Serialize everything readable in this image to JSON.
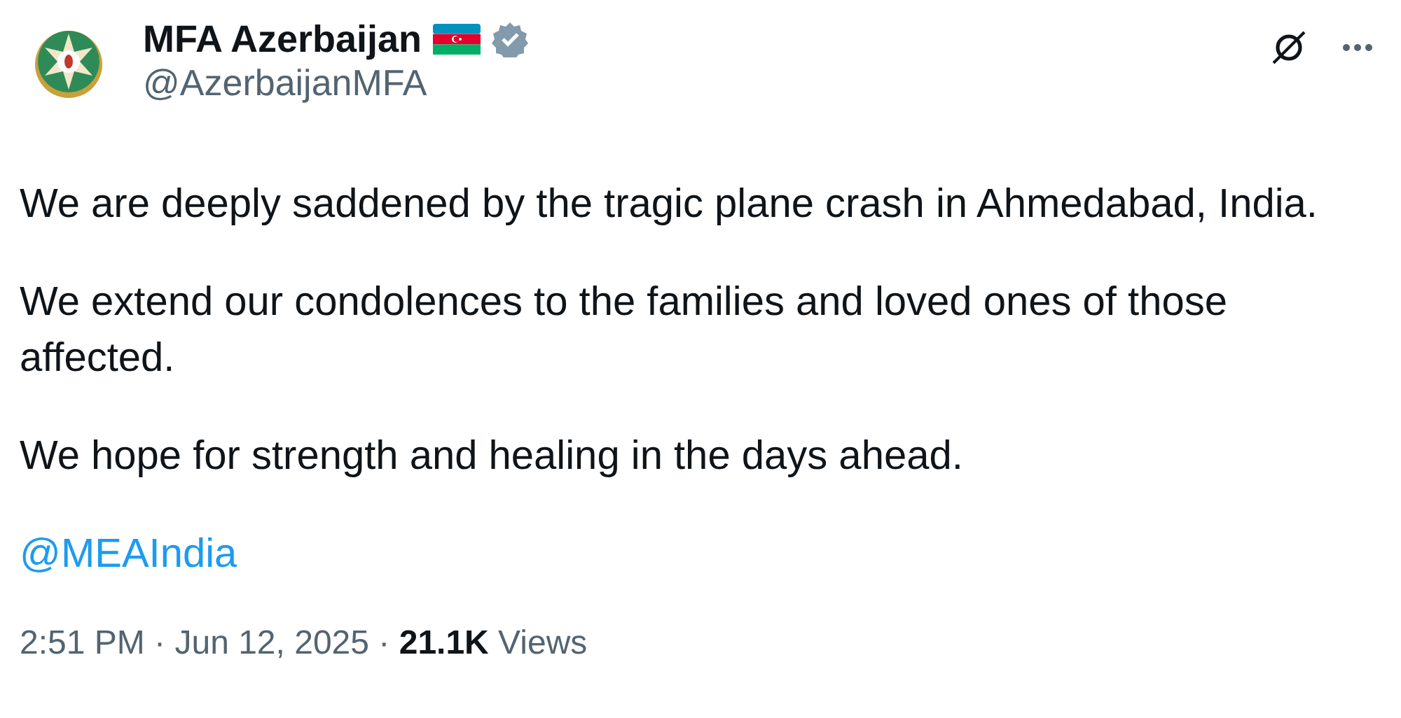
{
  "author": {
    "name": "MFA Azerbaijan",
    "handle": "@AzerbaijanMFA",
    "verified": true
  },
  "paragraphs": [
    "We are deeply saddened by the tragic plane crash in Ahmedabad, India.",
    "We extend our condolences to the families and loved ones of those affected.",
    "We hope for strength and healing in the days ahead."
  ],
  "mention": "@MEAIndia",
  "meta": {
    "separator": "·",
    "time": "2:51 PM",
    "date": "Jun 12, 2025",
    "views_count": "21.1K",
    "views_label": "Views"
  }
}
